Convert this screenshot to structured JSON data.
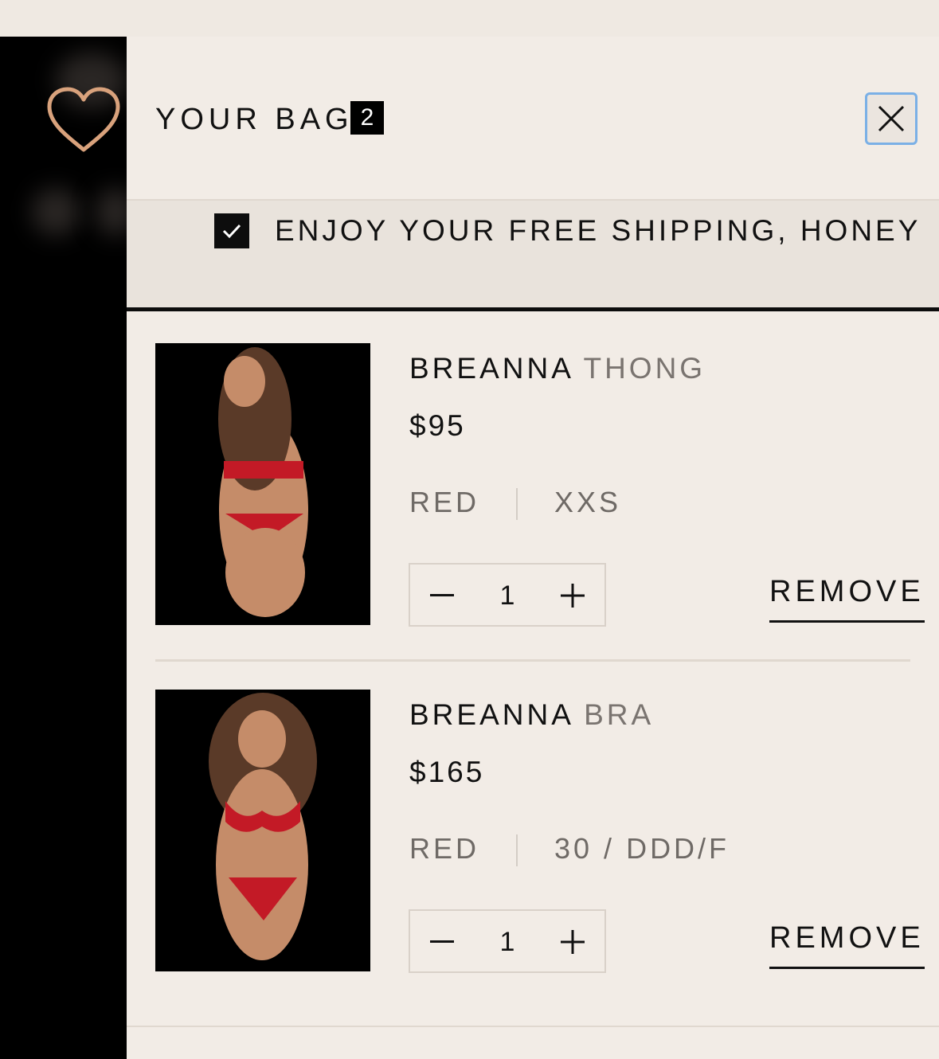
{
  "header": {
    "title": "YOUR BAG",
    "count": "2",
    "close_icon": "close-icon",
    "wishlist_icon": "heart-icon"
  },
  "shipping_banner": {
    "text": "ENJOY YOUR FREE SHIPPING, HONEY",
    "checked": true
  },
  "cart_items": [
    {
      "name": "BREANNA",
      "type": "THONG",
      "price": "$95",
      "color": "RED",
      "size": "XXS",
      "quantity": "1",
      "decrease_label": "−",
      "increase_label": "+",
      "remove_label": "REMOVE"
    },
    {
      "name": "BREANNA",
      "type": "BRA",
      "price": "$165",
      "color": "RED",
      "size": "30 / DDD/F",
      "quantity": "1",
      "decrease_label": "−",
      "increase_label": "+",
      "remove_label": "REMOVE"
    }
  ],
  "colors": {
    "panel_bg": "#f2ece6",
    "accent_heart": "#d9a27c",
    "product_red": "#c31a26",
    "focus_ring": "#7bb0e6"
  }
}
